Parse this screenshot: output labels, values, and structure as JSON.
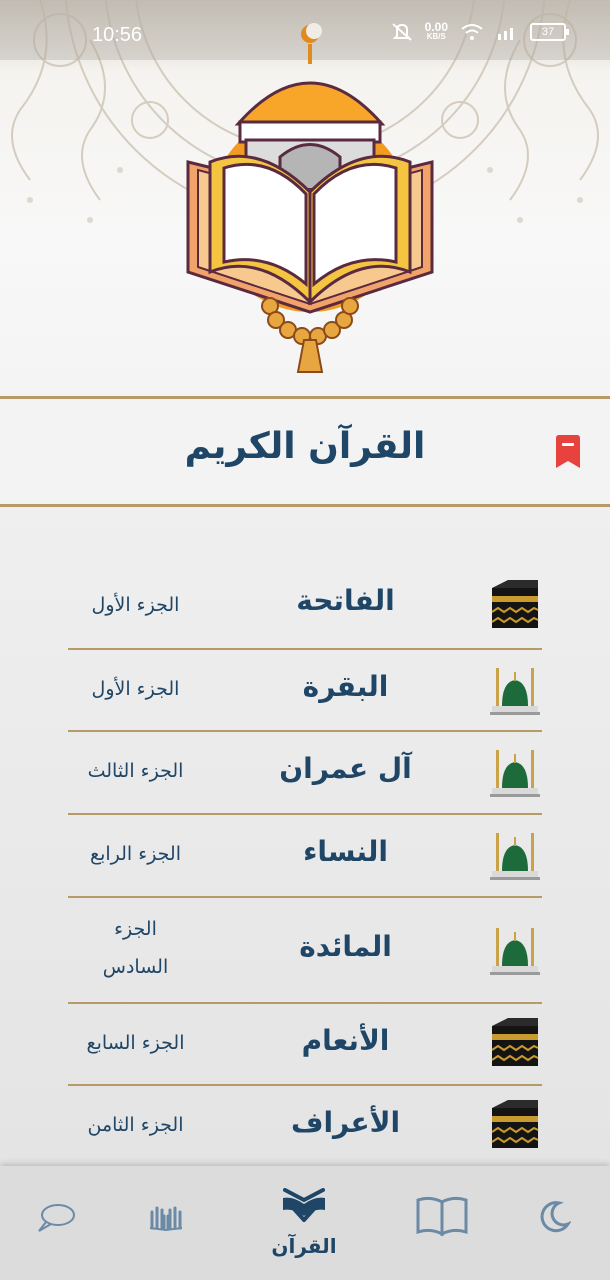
{
  "status_bar": {
    "time": "10:56",
    "net_speed_value": "0.00",
    "net_speed_unit": "KB/S",
    "battery": "37"
  },
  "header": {
    "title": "القرآن الكريم"
  },
  "surahs": [
    {
      "name": "الفاتحة",
      "juz": "الجزء الأول",
      "icon": "kaaba-icon"
    },
    {
      "name": "البقرة",
      "juz": "الجزء الأول",
      "icon": "mosque-icon"
    },
    {
      "name": "آل عمران",
      "juz": "الجزء الثالث",
      "icon": "mosque-icon"
    },
    {
      "name": "النساء",
      "juz": "الجزء الرابع",
      "icon": "mosque-icon"
    },
    {
      "name": "المائدة",
      "juz_line1": "الجزء",
      "juz_line2": "السادس",
      "icon": "mosque-icon"
    },
    {
      "name": "الأنعام",
      "juz": "الجزء السابع",
      "icon": "kaaba-icon"
    },
    {
      "name": "الأعراف",
      "juz": "الجزء الثامن",
      "icon": "kaaba-icon"
    }
  ],
  "bottom_nav": {
    "quran_label": "القرآن"
  },
  "colors": {
    "primary_text": "#1f4666",
    "divider": "#b89a68",
    "bookmark": "#e8423f"
  }
}
